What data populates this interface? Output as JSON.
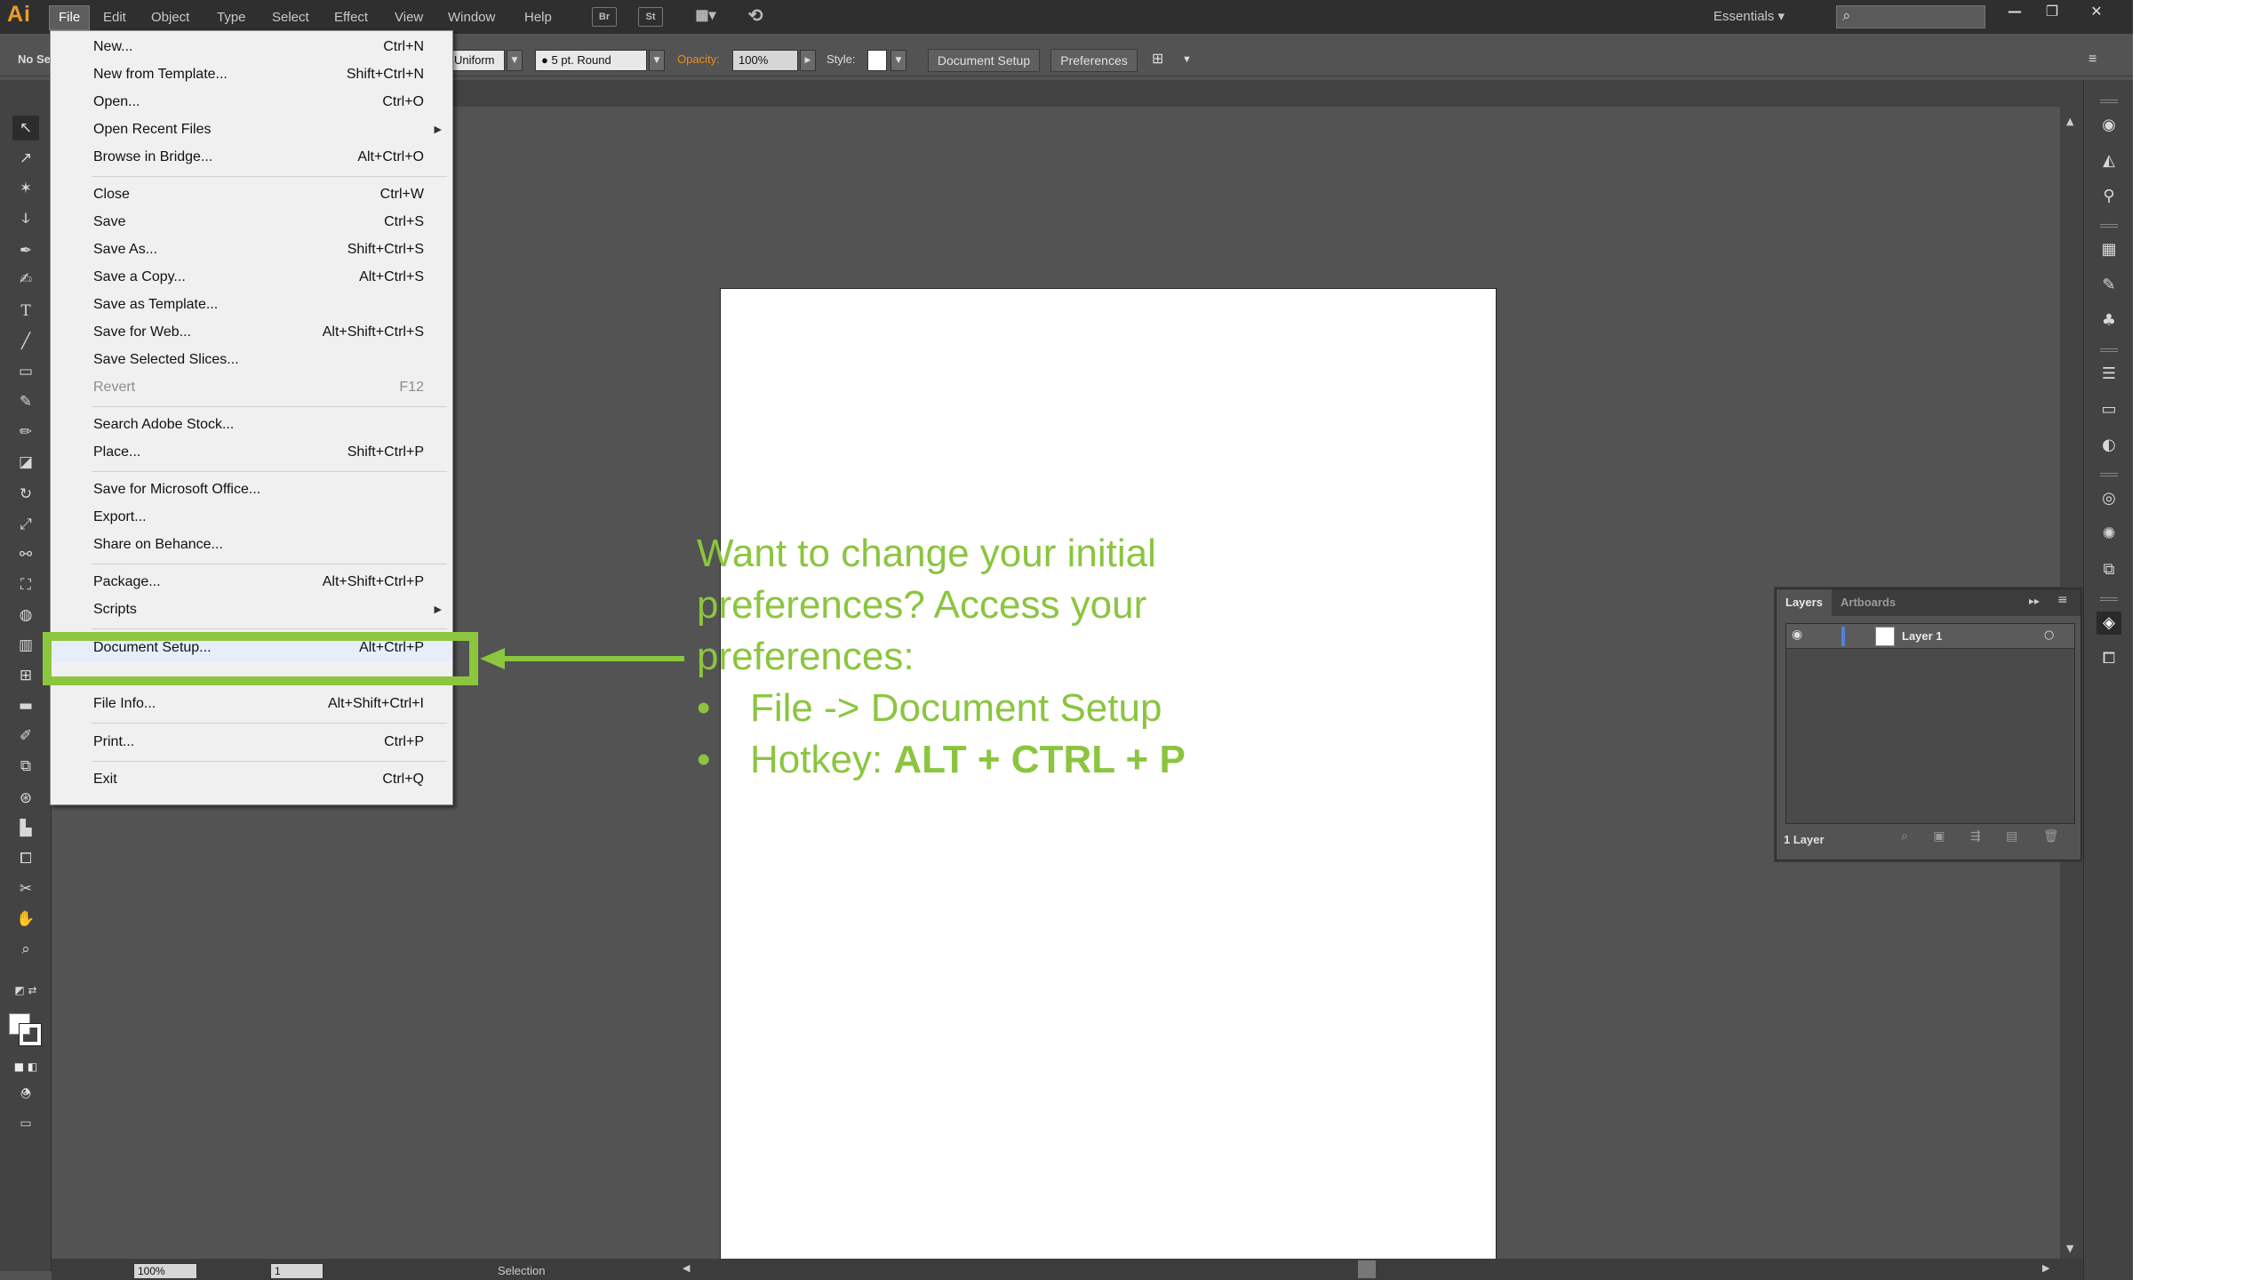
{
  "app": {
    "logo": "Ai",
    "menus": [
      "File",
      "Edit",
      "Object",
      "Type",
      "Select",
      "Effect",
      "View",
      "Window",
      "Help"
    ],
    "toolbar_icons": {
      "bridge": "Br",
      "stock": "St",
      "arrange": "▦▾",
      "sync": "⟲"
    },
    "workspace": "Essentials ▾",
    "window_controls": {
      "minimize": "—",
      "restore": "❐",
      "close": "✕"
    }
  },
  "control_bar": {
    "selection_label": "No Se",
    "stroke_profile": "Uniform",
    "brush": "● 5 pt. Round",
    "opacity_label": "Opacity:",
    "opacity_value": "100%",
    "style_label": "Style:",
    "document_setup_button": "Document Setup",
    "preferences_button": "Preferences"
  },
  "file_menu": {
    "items": [
      {
        "label": "New...",
        "shortcut": "Ctrl+N"
      },
      {
        "label": "New from Template...",
        "shortcut": "Shift+Ctrl+N"
      },
      {
        "label": "Open...",
        "shortcut": "Ctrl+O"
      },
      {
        "label": "Open Recent Files",
        "shortcut": "",
        "submenu": "▶"
      },
      {
        "label": "Browse in Bridge...",
        "shortcut": "Alt+Ctrl+O"
      },
      {
        "label": "Close",
        "shortcut": "Ctrl+W"
      },
      {
        "label": "Save",
        "shortcut": "Ctrl+S"
      },
      {
        "label": "Save As...",
        "shortcut": "Shift+Ctrl+S"
      },
      {
        "label": "Save a Copy...",
        "shortcut": "Alt+Ctrl+S"
      },
      {
        "label": "Save as Template...",
        "shortcut": ""
      },
      {
        "label": "Save for Web...",
        "shortcut": "Alt+Shift+Ctrl+S"
      },
      {
        "label": "Save Selected Slices...",
        "shortcut": ""
      },
      {
        "label": "Revert",
        "shortcut": "F12"
      },
      {
        "label": "Search Adobe Stock...",
        "shortcut": ""
      },
      {
        "label": "Place...",
        "shortcut": "Shift+Ctrl+P"
      },
      {
        "label": "Save for Microsoft Office...",
        "shortcut": ""
      },
      {
        "label": "Export...",
        "shortcut": ""
      },
      {
        "label": "Share on Behance...",
        "shortcut": ""
      },
      {
        "label": "Package...",
        "shortcut": "Alt+Shift+Ctrl+P"
      },
      {
        "label": "Scripts",
        "shortcut": "",
        "submenu": "▶"
      },
      {
        "label": "Document Setup...",
        "shortcut": "Alt+Ctrl+P"
      },
      {
        "label": "File Info...",
        "shortcut": "Alt+Shift+Ctrl+I"
      },
      {
        "label": "Print...",
        "shortcut": "Ctrl+P"
      },
      {
        "label": "Exit",
        "shortcut": "Ctrl+Q"
      }
    ]
  },
  "annotation": {
    "line1": "Want to change your initial",
    "line2": "preferences? Access your",
    "line3": "preferences:",
    "bullet_marker": "•",
    "bullet1": "File -> Document Setup",
    "bullet2_prefix": "Hotkey: ",
    "bullet2_bold": "ALT + CTRL + P",
    "accent_color": "#8cc63f"
  },
  "layers_panel": {
    "tab_layers": "Layers",
    "tab_artboards": "Artboards",
    "layer_name": "Layer 1",
    "footer": "1 Layer"
  },
  "status_bar": {
    "zoom": "100%",
    "artboard_number": "1",
    "mode": "Selection"
  }
}
